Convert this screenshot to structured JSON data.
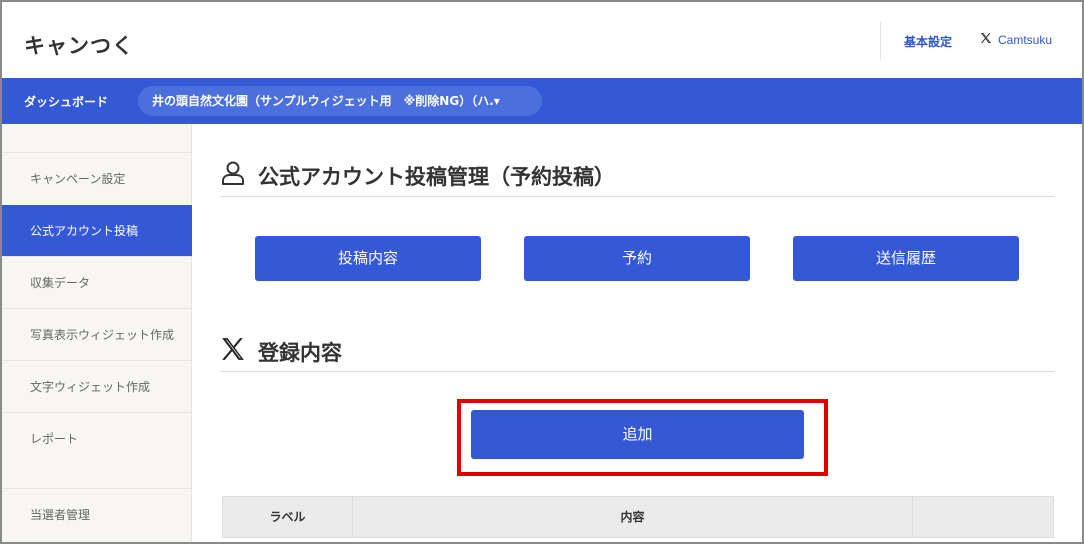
{
  "header": {
    "app_title": "キャンつく",
    "settings_link": "基本設定",
    "x_account_name": "Camtsuku"
  },
  "bluebar": {
    "dashboard_label": "ダッシュボード",
    "campaign_name": "井の頭自然文化園（サンプルウィジェット用　※削除NG）（ハ.▾"
  },
  "sidebar": {
    "items": [
      {
        "label": "キャンペーン設定",
        "active": false
      },
      {
        "label": "公式アカウント投稿",
        "active": true
      },
      {
        "label": "収集データ",
        "active": false
      },
      {
        "label": "写真表示ウィジェット作成",
        "active": false
      },
      {
        "label": "文字ウィジェット作成",
        "active": false
      },
      {
        "label": "レポート",
        "active": false
      },
      {
        "label": "当選者管理",
        "active": false
      }
    ]
  },
  "main": {
    "page_title": "公式アカウント投稿管理（予約投稿）",
    "tabs": [
      {
        "label": "投稿内容"
      },
      {
        "label": "予約"
      },
      {
        "label": "送信履歴"
      }
    ],
    "registration_title": "登録内容",
    "add_button": "追加",
    "table": {
      "columns": [
        "ラベル",
        "内容",
        ""
      ]
    }
  },
  "colors": {
    "primary": "#3558d6",
    "highlight": "#e00000",
    "link": "#2f55c9"
  }
}
